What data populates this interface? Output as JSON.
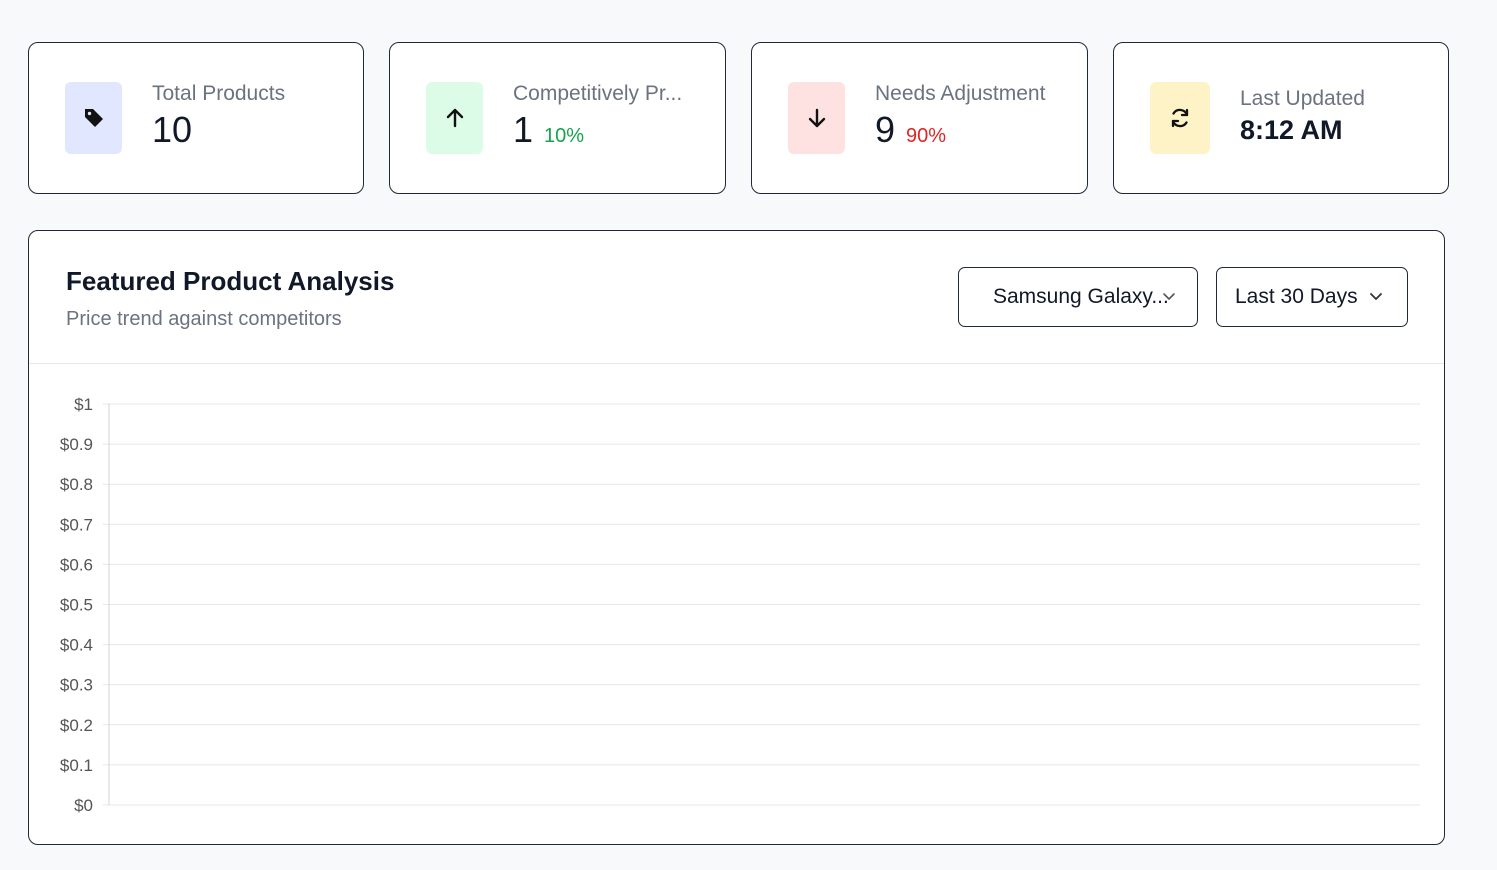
{
  "stats": [
    {
      "label": "Total Products",
      "value": "10",
      "pct": "",
      "icon": "tag-icon",
      "icon_bg": "#e0e7ff"
    },
    {
      "label": "Competitively Pr...",
      "value": "1",
      "pct": "10%",
      "icon": "arrow-up-icon",
      "icon_bg": "#dcfce7",
      "pct_color": "#16a34a"
    },
    {
      "label": "Needs Adjustment",
      "value": "9",
      "pct": "90%",
      "icon": "arrow-down-icon",
      "icon_bg": "#fee2e2",
      "pct_color": "#dc2626"
    },
    {
      "label": "Last Updated",
      "value": "8:12 AM",
      "pct": "",
      "icon": "refresh-icon",
      "icon_bg": "#fef3c7"
    }
  ],
  "panel": {
    "title": "Featured Product Analysis",
    "subtitle": "Price trend against competitors",
    "product_select": {
      "value": "Samsung Galaxy..."
    },
    "range_select": {
      "value": "Last 30 Days"
    }
  },
  "chart_data": {
    "type": "line",
    "series": [],
    "ylim": [
      0,
      1
    ],
    "y_ticks": [
      "$0",
      "$0.1",
      "$0.2",
      "$0.3",
      "$0.4",
      "$0.5",
      "$0.6",
      "$0.7",
      "$0.8",
      "$0.9",
      "$1"
    ],
    "grid": true
  }
}
